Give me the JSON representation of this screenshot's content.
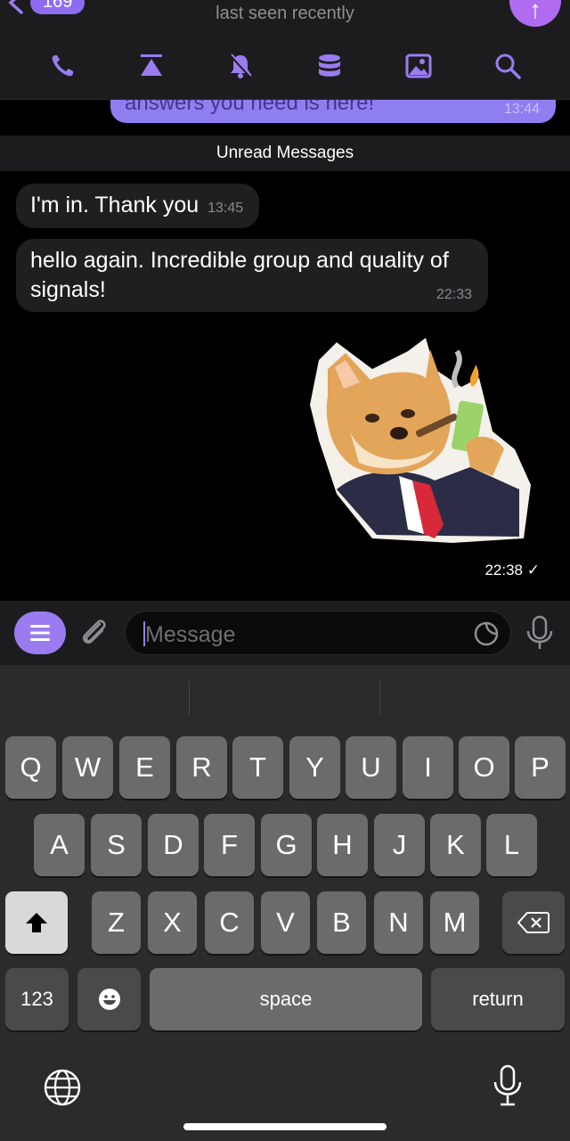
{
  "header": {
    "back_count": "169",
    "subtitle": "last seen recently",
    "toolbar": [
      "phone-icon",
      "pin-icon",
      "bell-off-icon",
      "database-icon",
      "gallery-icon",
      "search-icon"
    ]
  },
  "chat": {
    "outgoing_partial": {
      "text": "answers you need is here!",
      "time": "13:44"
    },
    "unread_label": "Unread Messages",
    "messages": [
      {
        "text": "I'm in. Thank you",
        "time": "13:45"
      },
      {
        "text": "hello again. Incredible group and quality of signals!",
        "time": "22:33"
      }
    ],
    "sticker_time": "22:38"
  },
  "composer": {
    "placeholder": "Message"
  },
  "keyboard": {
    "row1": [
      "Q",
      "W",
      "E",
      "R",
      "T",
      "Y",
      "U",
      "I",
      "O",
      "P"
    ],
    "row2": [
      "A",
      "S",
      "D",
      "F",
      "G",
      "H",
      "J",
      "K",
      "L"
    ],
    "row3": [
      "Z",
      "X",
      "C",
      "V",
      "B",
      "N",
      "M"
    ],
    "numbers_label": "123",
    "space_label": "space",
    "return_label": "return"
  },
  "colors": {
    "accent": "#9a7cf0",
    "bubble_in": "#1f1f22",
    "bubble_out": "#8e7ef0"
  }
}
